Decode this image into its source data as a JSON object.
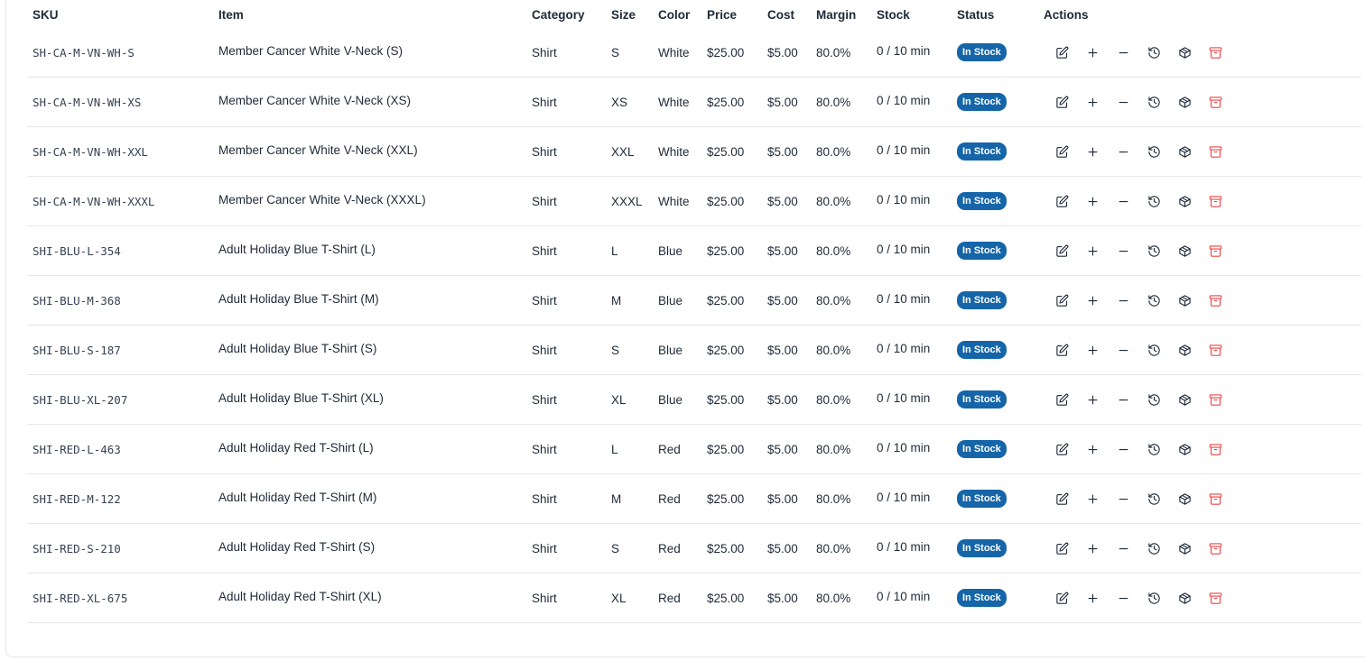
{
  "table": {
    "columns": [
      "SKU",
      "Item",
      "Category",
      "Size",
      "Color",
      "Price",
      "Cost",
      "Margin",
      "Stock",
      "Status",
      "Actions"
    ],
    "rows": [
      {
        "sku": "SH-CA-M-VN-WH-S",
        "item": "Member Cancer White V-Neck (S)",
        "category": "Shirt",
        "size": "S",
        "color": "White",
        "price": "$25.00",
        "cost": "$5.00",
        "margin": "80.0%",
        "stock": "0 / 10 min",
        "status": "In Stock"
      },
      {
        "sku": "SH-CA-M-VN-WH-XS",
        "item": "Member Cancer White V-Neck (XS)",
        "category": "Shirt",
        "size": "XS",
        "color": "White",
        "price": "$25.00",
        "cost": "$5.00",
        "margin": "80.0%",
        "stock": "0 / 10 min",
        "status": "In Stock"
      },
      {
        "sku": "SH-CA-M-VN-WH-XXL",
        "item": "Member Cancer White V-Neck (XXL)",
        "category": "Shirt",
        "size": "XXL",
        "color": "White",
        "price": "$25.00",
        "cost": "$5.00",
        "margin": "80.0%",
        "stock": "0 / 10 min",
        "status": "In Stock"
      },
      {
        "sku": "SH-CA-M-VN-WH-XXXL",
        "item": "Member Cancer White V-Neck (XXXL)",
        "category": "Shirt",
        "size": "XXXL",
        "color": "White",
        "price": "$25.00",
        "cost": "$5.00",
        "margin": "80.0%",
        "stock": "0 / 10 min",
        "status": "In Stock"
      },
      {
        "sku": "SHI-BLU-L-354",
        "item": "Adult Holiday Blue T-Shirt (L)",
        "category": "Shirt",
        "size": "L",
        "color": "Blue",
        "price": "$25.00",
        "cost": "$5.00",
        "margin": "80.0%",
        "stock": "0 / 10 min",
        "status": "In Stock"
      },
      {
        "sku": "SHI-BLU-M-368",
        "item": "Adult Holiday Blue T-Shirt (M)",
        "category": "Shirt",
        "size": "M",
        "color": "Blue",
        "price": "$25.00",
        "cost": "$5.00",
        "margin": "80.0%",
        "stock": "0 / 10 min",
        "status": "In Stock"
      },
      {
        "sku": "SHI-BLU-S-187",
        "item": "Adult Holiday Blue T-Shirt (S)",
        "category": "Shirt",
        "size": "S",
        "color": "Blue",
        "price": "$25.00",
        "cost": "$5.00",
        "margin": "80.0%",
        "stock": "0 / 10 min",
        "status": "In Stock"
      },
      {
        "sku": "SHI-BLU-XL-207",
        "item": "Adult Holiday Blue T-Shirt (XL)",
        "category": "Shirt",
        "size": "XL",
        "color": "Blue",
        "price": "$25.00",
        "cost": "$5.00",
        "margin": "80.0%",
        "stock": "0 / 10 min",
        "status": "In Stock"
      },
      {
        "sku": "SHI-RED-L-463",
        "item": "Adult Holiday Red T-Shirt (L)",
        "category": "Shirt",
        "size": "L",
        "color": "Red",
        "price": "$25.00",
        "cost": "$5.00",
        "margin": "80.0%",
        "stock": "0 / 10 min",
        "status": "In Stock"
      },
      {
        "sku": "SHI-RED-M-122",
        "item": "Adult Holiday Red T-Shirt (M)",
        "category": "Shirt",
        "size": "M",
        "color": "Red",
        "price": "$25.00",
        "cost": "$5.00",
        "margin": "80.0%",
        "stock": "0 / 10 min",
        "status": "In Stock"
      },
      {
        "sku": "SHI-RED-S-210",
        "item": "Adult Holiday Red T-Shirt (S)",
        "category": "Shirt",
        "size": "S",
        "color": "Red",
        "price": "$25.00",
        "cost": "$5.00",
        "margin": "80.0%",
        "stock": "0 / 10 min",
        "status": "In Stock"
      },
      {
        "sku": "SHI-RED-XL-675",
        "item": "Adult Holiday Red T-Shirt (XL)",
        "category": "Shirt",
        "size": "XL",
        "color": "Red",
        "price": "$25.00",
        "cost": "$5.00",
        "margin": "80.0%",
        "stock": "0 / 10 min",
        "status": "In Stock"
      }
    ],
    "row_actions": [
      {
        "name": "edit-icon",
        "danger": false
      },
      {
        "name": "plus-icon",
        "danger": false
      },
      {
        "name": "minus-icon",
        "danger": false
      },
      {
        "name": "history-icon",
        "danger": false
      },
      {
        "name": "package-icon",
        "danger": false
      },
      {
        "name": "archive-icon",
        "danger": true
      }
    ]
  },
  "colors": {
    "status_badge_bg": "#1565a8",
    "danger": "#ef4444",
    "row_border": "#e5e7eb"
  }
}
